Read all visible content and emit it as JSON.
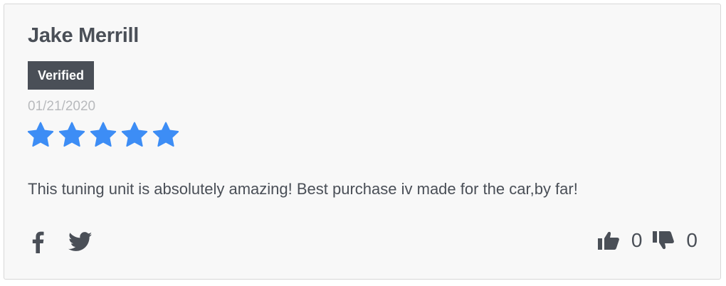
{
  "review": {
    "author": "Jake Merrill",
    "badge": "Verified",
    "date": "01/21/2020",
    "rating": 5,
    "rating_max": 5,
    "body": "This tuning unit is absolutely amazing! Best purchase iv made for the car,by far!"
  },
  "share": {
    "facebook_icon": "facebook-icon",
    "twitter_icon": "twitter-icon"
  },
  "votes": {
    "up_icon": "thumbs-up-icon",
    "up_count": "0",
    "down_icon": "thumbs-down-icon",
    "down_count": "0"
  },
  "colors": {
    "star": "#3d8df5",
    "text": "#4a4f57",
    "badge_bg": "#4a4f57",
    "date": "#b8babd",
    "card_bg": "#f8f8f8",
    "card_border": "#d8d8d8"
  }
}
